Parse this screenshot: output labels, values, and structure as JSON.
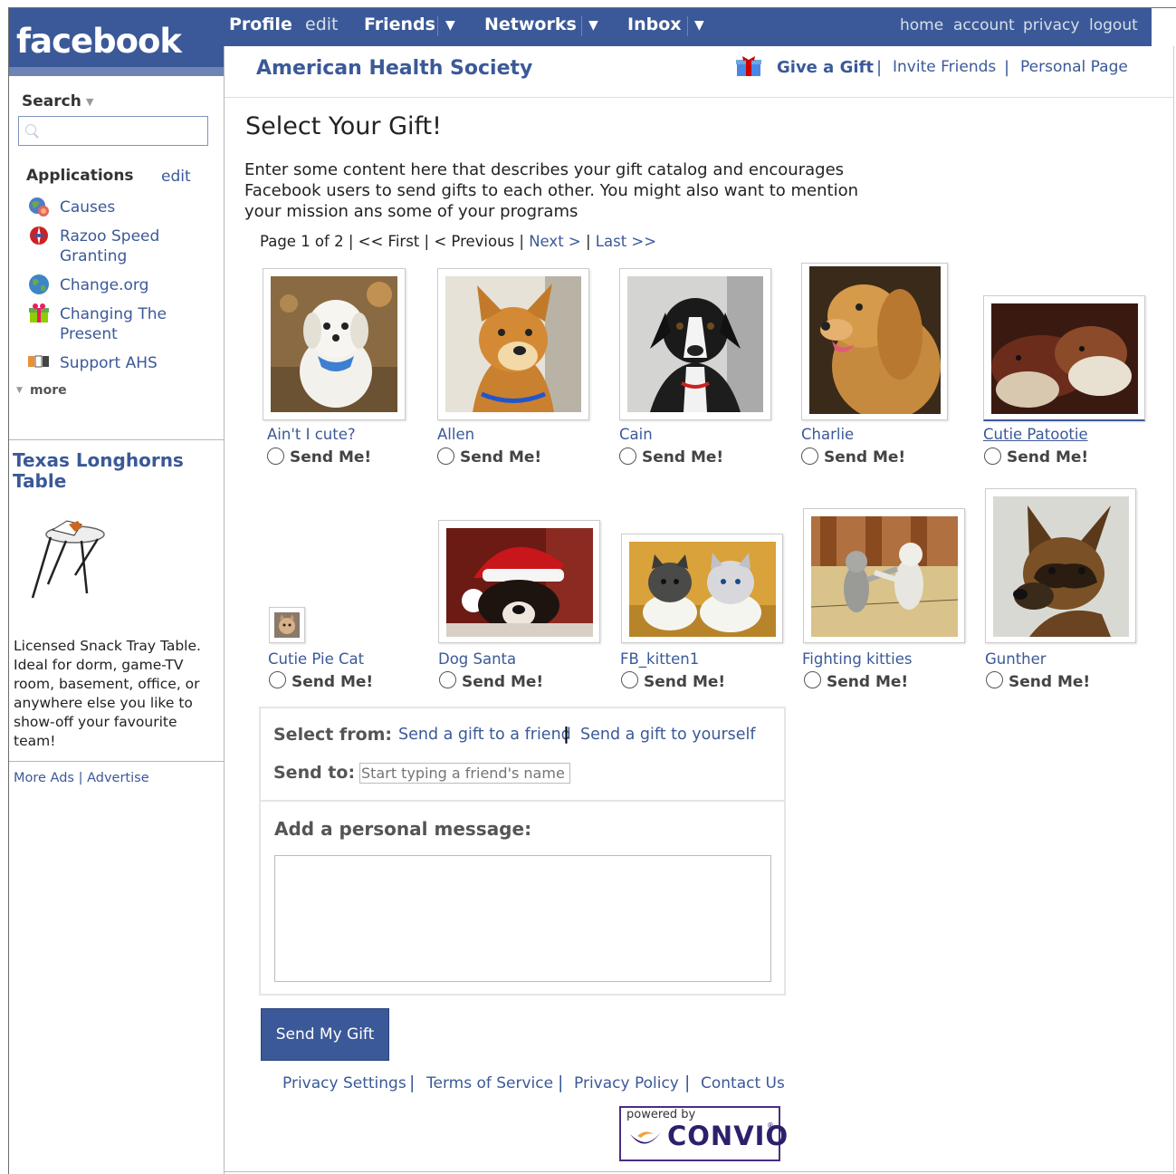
{
  "topnav": {
    "logo": "facebook",
    "profile": "Profile",
    "edit": "edit",
    "friends": "Friends",
    "networks": "Networks",
    "inbox": "Inbox",
    "caret": "▼",
    "right": [
      "home",
      "account",
      "privacy",
      "logout"
    ]
  },
  "sidebar": {
    "search_label": "Search",
    "search_caret": "▼",
    "applications_label": "Applications",
    "applications_edit": "edit",
    "apps": [
      {
        "label": "Causes",
        "icon": "causes-icon"
      },
      {
        "label": "Razoo Speed Granting",
        "icon": "razoo-icon"
      },
      {
        "label": "Change.org",
        "icon": "globe-icon"
      },
      {
        "label": "Changing The Present",
        "icon": "gift-icon"
      },
      {
        "label": "Support AHS",
        "icon": "ahs-icon"
      }
    ],
    "more": "more",
    "more_caret": "▼",
    "ad": {
      "title": "Texas Longhorns Table",
      "text": "Licensed Snack Tray Table. Ideal for dorm, game-TV room, basement, office, or anywhere else you like to show-off your favourite team!",
      "more_ads": "More Ads",
      "advertise": "Advertise",
      "sep": "|"
    }
  },
  "app_header": {
    "title": "American Health Society",
    "give_gift": "Give a Gift",
    "invite_friends": "Invite Friends",
    "personal_page": "Personal Page",
    "sep": "|"
  },
  "main": {
    "heading": "Select Your Gift!",
    "intro": "Enter some content here that describes your gift catalog and encourages Facebook users to send gifts to each other. You might also want to mention your mission ans some of your programs",
    "pager": {
      "status": "Page 1 of 2",
      "first": "<< First",
      "previous": "< Previous",
      "next": "Next >",
      "last": "Last >>",
      "sep": "|"
    },
    "send_label": "Send Me!",
    "gifts": [
      {
        "name": "Ain't I cute?",
        "photo": "white-puppy"
      },
      {
        "name": "Allen",
        "photo": "orange-dog"
      },
      {
        "name": "Cain",
        "photo": "black-white-dog"
      },
      {
        "name": "Charlie",
        "photo": "cocker-spaniel"
      },
      {
        "name": "Cutie Patootie",
        "photo": "sleeping-dogs"
      },
      {
        "name": "Cutie Pie Cat",
        "photo": "small-cat"
      },
      {
        "name": "Dog Santa",
        "photo": "dog-santa-hat"
      },
      {
        "name": "FB_kitten1",
        "photo": "kittens-in-cups"
      },
      {
        "name": "Fighting kitties",
        "photo": "fighting-kittens"
      },
      {
        "name": "Gunther",
        "photo": "german-shepherd"
      }
    ]
  },
  "form": {
    "select_from": "Select from:",
    "to_friend": "Send a gift to a friend",
    "sep": "|",
    "to_self": "Send a gift to yourself",
    "send_to": "Send to:",
    "send_to_placeholder": "Start typing a friend's name",
    "message_label": "Add a personal message:",
    "submit": "Send My Gift"
  },
  "footer": {
    "links": [
      "Privacy Settings",
      "Terms of Service",
      "Privacy Policy",
      "Contact Us"
    ],
    "sep": "|",
    "powered_by": "powered by",
    "brand": "CONVIO",
    "brand_mark": "®"
  },
  "colors": {
    "facebook_blue": "#3b5998",
    "nav_light": "#6d84b4",
    "convio_purple": "#4a2e83"
  }
}
